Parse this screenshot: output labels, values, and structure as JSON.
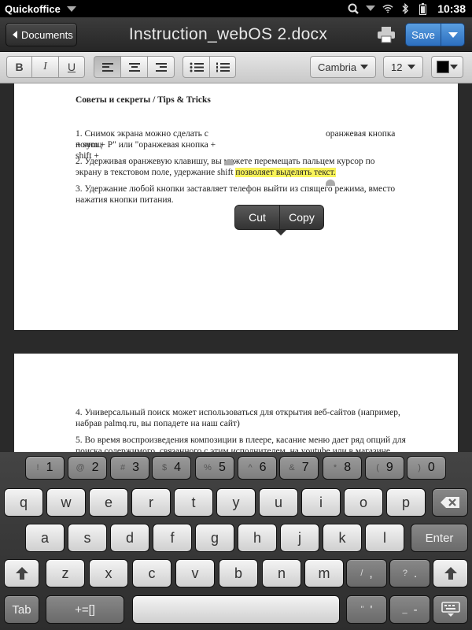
{
  "status_bar": {
    "app_name": "Quickoffice",
    "time": "10:38"
  },
  "title_bar": {
    "back_label": "Documents",
    "doc_title": "Instruction_webOS 2.docx",
    "save_label": "Save"
  },
  "toolbar": {
    "bold": "B",
    "italic": "I",
    "underline": "U",
    "font": "Cambria",
    "font_size": "12",
    "text_color": "#000000"
  },
  "document": {
    "page1": {
      "heading": "Советы и секреты / Tips & Tricks",
      "tip1_line1_a": "1. Снимок экрана можно сделать с помощ",
      "tip1_line1_b": "оранжевая кнопка",
      "tip1_line2": "+ sym + P\" или \"оранжевая кнопка + shift +",
      "tip2_line1": "2. Удерживая оранжевую клавишу, вы можете перемещать пальцем курсор по",
      "tip2_line2_a": "экрану в текстовом поле, удержание shift",
      "tip2_line2_highlight": "позволяет выделять текст.",
      "tip3_line1": "3. Удержание любой кнопки заставляет телефон выйти из спящего режима, вместо",
      "tip3_line2": "нажатия кнопки питания."
    },
    "page2": {
      "tip4_line1": "4. Универсальный поиск может использоваться для открытия веб-сайтов (например,",
      "tip4_line2": "набрав palmq.ru, вы попадете на наш сайт)",
      "tip5_line1": "5. Во время воспроизведения композиции в плеере, касание меню дает ряд опций для",
      "tip5_line2": "поиска содержимого, связанного с этим исполнителем, на youtube или в магазине"
    }
  },
  "context_menu": {
    "cut": "Cut",
    "copy": "Copy"
  },
  "keyboard": {
    "number_row": [
      {
        "sym": "!",
        "main": "1"
      },
      {
        "sym": "@",
        "main": "2"
      },
      {
        "sym": "#",
        "main": "3"
      },
      {
        "sym": "$",
        "main": "4"
      },
      {
        "sym": "%",
        "main": "5"
      },
      {
        "sym": "^",
        "main": "6"
      },
      {
        "sym": "&",
        "main": "7"
      },
      {
        "sym": "*",
        "main": "8"
      },
      {
        "sym": "(",
        "main": "9"
      },
      {
        "sym": ")",
        "main": "0"
      }
    ],
    "row1": [
      "q",
      "w",
      "e",
      "r",
      "t",
      "y",
      "u",
      "i",
      "o",
      "p"
    ],
    "row2": [
      "a",
      "s",
      "d",
      "f",
      "g",
      "h",
      "j",
      "k",
      "l"
    ],
    "row3": [
      "z",
      "x",
      "c",
      "v",
      "b",
      "n",
      "m"
    ],
    "enter": "Enter",
    "tab": "Tab",
    "symbols": "+=[]",
    "slash_sym": "/",
    "comma": ",",
    "question_sym": "?",
    "period": ".",
    "quote_sym": "\"",
    "apostrophe": "'",
    "underscore_sym": "_",
    "dash": "-"
  }
}
